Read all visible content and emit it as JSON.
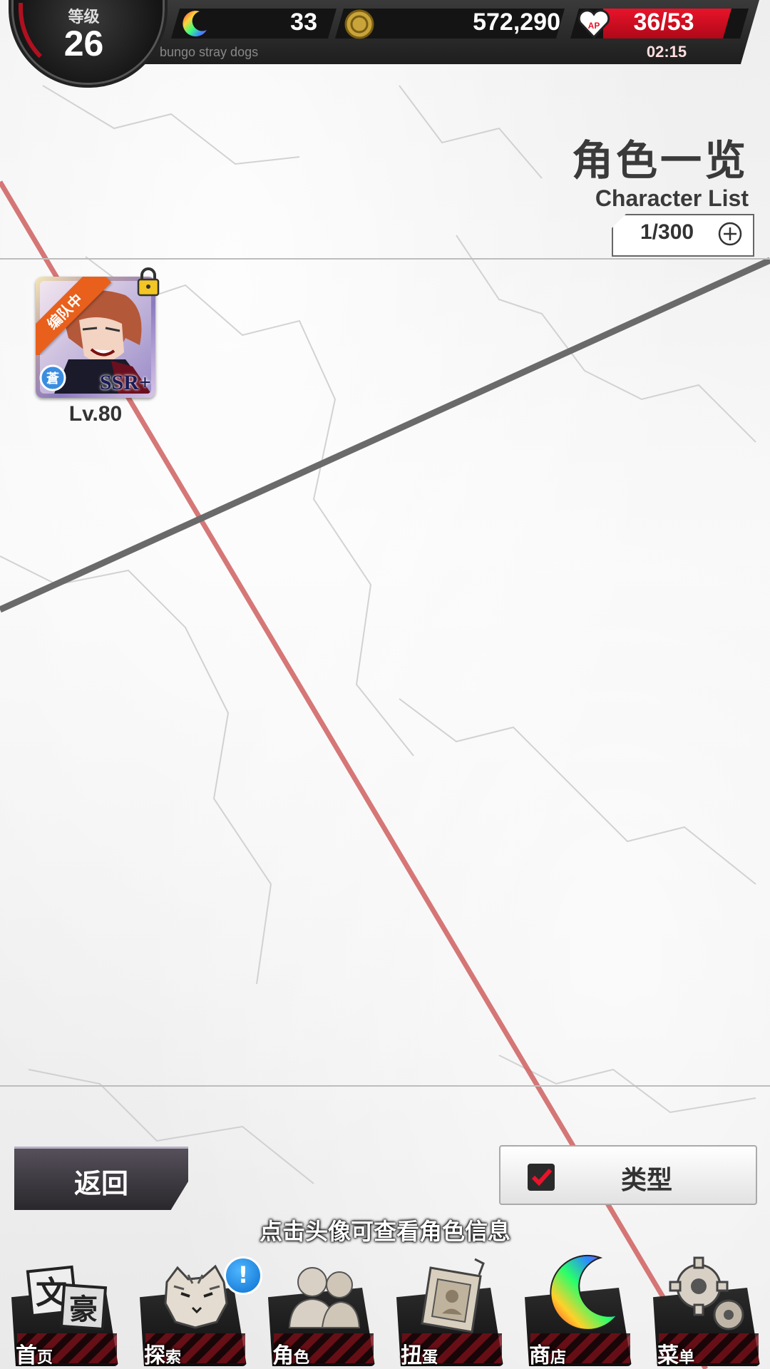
{
  "player": {
    "level_label": "等级",
    "level": "26",
    "game_name": "bungo stray dogs"
  },
  "currency": {
    "gems": "33",
    "coins": "572,290",
    "ap": "36/53",
    "ap_fraction": 0.68,
    "ap_timer": "02:15",
    "ap_icon_label": "AP"
  },
  "header": {
    "title": "角色一览",
    "subtitle": "Character List",
    "count": "1/300"
  },
  "characters": [
    {
      "team_tag": "编队中",
      "attribute": "蒼",
      "rarity": "SSR+",
      "level": "Lv.80",
      "locked": true
    }
  ],
  "buttons": {
    "back": "返回",
    "type": "类型"
  },
  "hint": "点击头像可查看角色信息",
  "nav": {
    "home": {
      "big": "首",
      "small": "页",
      "icon": "bungo-logo-icon"
    },
    "explore": {
      "big": "探",
      "small": "索",
      "icon": "tiger-icon",
      "alert": "!"
    },
    "characters": {
      "big": "角",
      "small": "色",
      "icon": "people-icon"
    },
    "gacha": {
      "big": "扭",
      "small": "蛋",
      "icon": "book-icon"
    },
    "shop": {
      "big": "商",
      "small": "店",
      "icon": "moon-icon"
    },
    "menu": {
      "big": "菜",
      "small": "单",
      "icon": "gear-icon"
    }
  },
  "colors": {
    "accent_red": "#e8142a",
    "team_orange": "#e8601c",
    "dark_bar": "#1e1e1e"
  }
}
